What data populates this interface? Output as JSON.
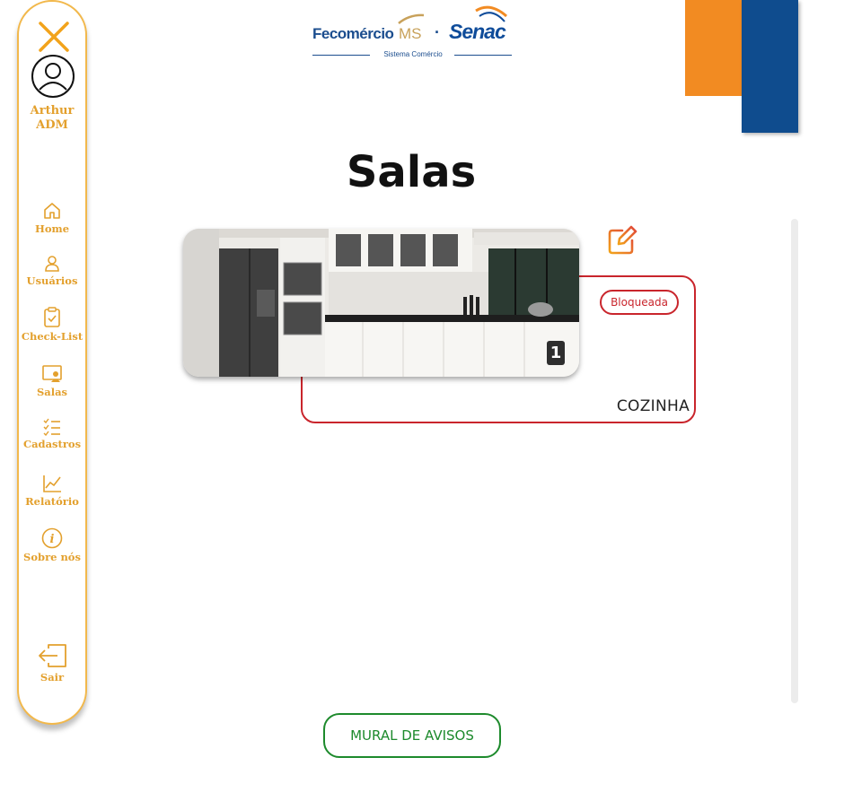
{
  "sidebar": {
    "user": {
      "name": "Arthur ADM"
    },
    "items": [
      {
        "label": "Home",
        "icon": "home-icon"
      },
      {
        "label": "Usuários",
        "icon": "user-icon"
      },
      {
        "label": "Check-List",
        "icon": "clipboard-check-icon"
      },
      {
        "label": "Salas",
        "icon": "classroom-icon"
      },
      {
        "label": "Cadastros",
        "icon": "list-check-icon"
      },
      {
        "label": "Relatório",
        "icon": "chart-line-icon"
      },
      {
        "label": "Sobre nós",
        "icon": "info-icon"
      }
    ],
    "logout_label": "Sair"
  },
  "header": {
    "logo": {
      "brand1": "Fecomércio",
      "brand1_suffix": "MS",
      "separator": "·",
      "brand2": "Senac",
      "tagline": "Sistema Comércio"
    }
  },
  "page": {
    "title": "Salas"
  },
  "rooms": [
    {
      "name": "COZINHA",
      "status": "Bloqueada",
      "count": "1"
    }
  ],
  "footer": {
    "mural_label": "MURAL DE AVISOS"
  },
  "colors": {
    "accent": "#e3a02d",
    "sidebar_border": "#f2b84b",
    "orange_block": "#f28b22",
    "blue_block": "#0f4c8e",
    "status_blocked": "#c9252c",
    "mural_green": "#1d8a2c"
  }
}
